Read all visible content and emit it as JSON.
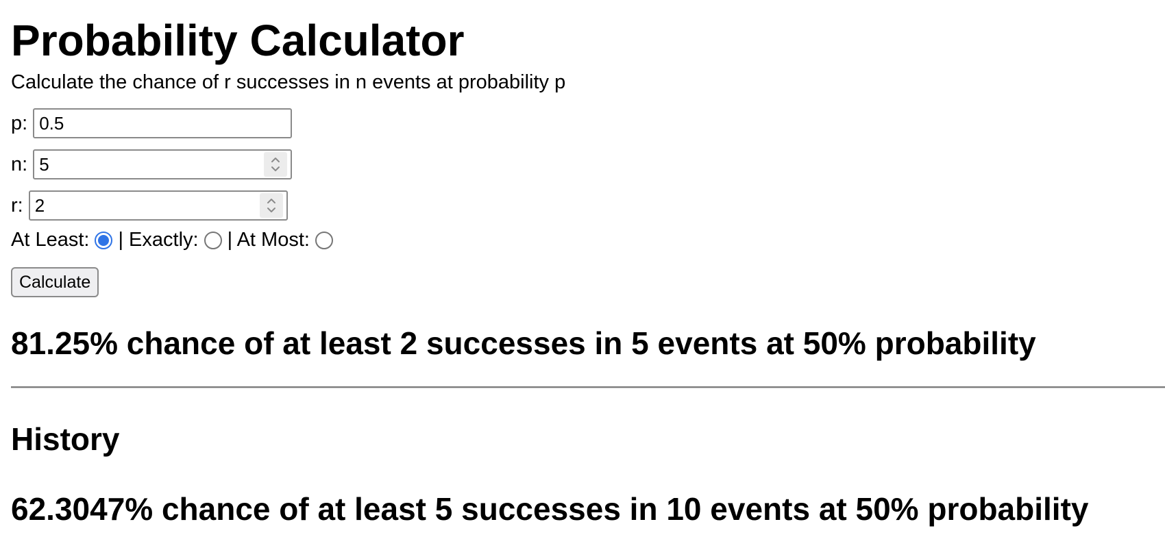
{
  "header": {
    "title": "Probability Calculator",
    "subtitle": "Calculate the chance of r successes in n events at probability p"
  },
  "form": {
    "p": {
      "label": "p:",
      "value": "0.5"
    },
    "n": {
      "label": "n:",
      "value": "5"
    },
    "r": {
      "label": "r:",
      "value": "2"
    },
    "mode": {
      "at_least_label": "At Least:",
      "exactly_label": "| Exactly:",
      "at_most_label": "| At Most:",
      "selected": "at_least"
    },
    "calculate_label": "Calculate"
  },
  "result": "81.25% chance of at least 2 successes in 5 events at 50% probability",
  "history": {
    "title": "History",
    "items": [
      "62.3047% chance of at least 5 successes in 10 events at 50% probability"
    ]
  },
  "colors": {
    "accent": "#2f74e6",
    "border": "#8a8a8a",
    "button_bg": "#efeff1"
  },
  "icons": {
    "spinner": "chevron-up-down-icon"
  }
}
